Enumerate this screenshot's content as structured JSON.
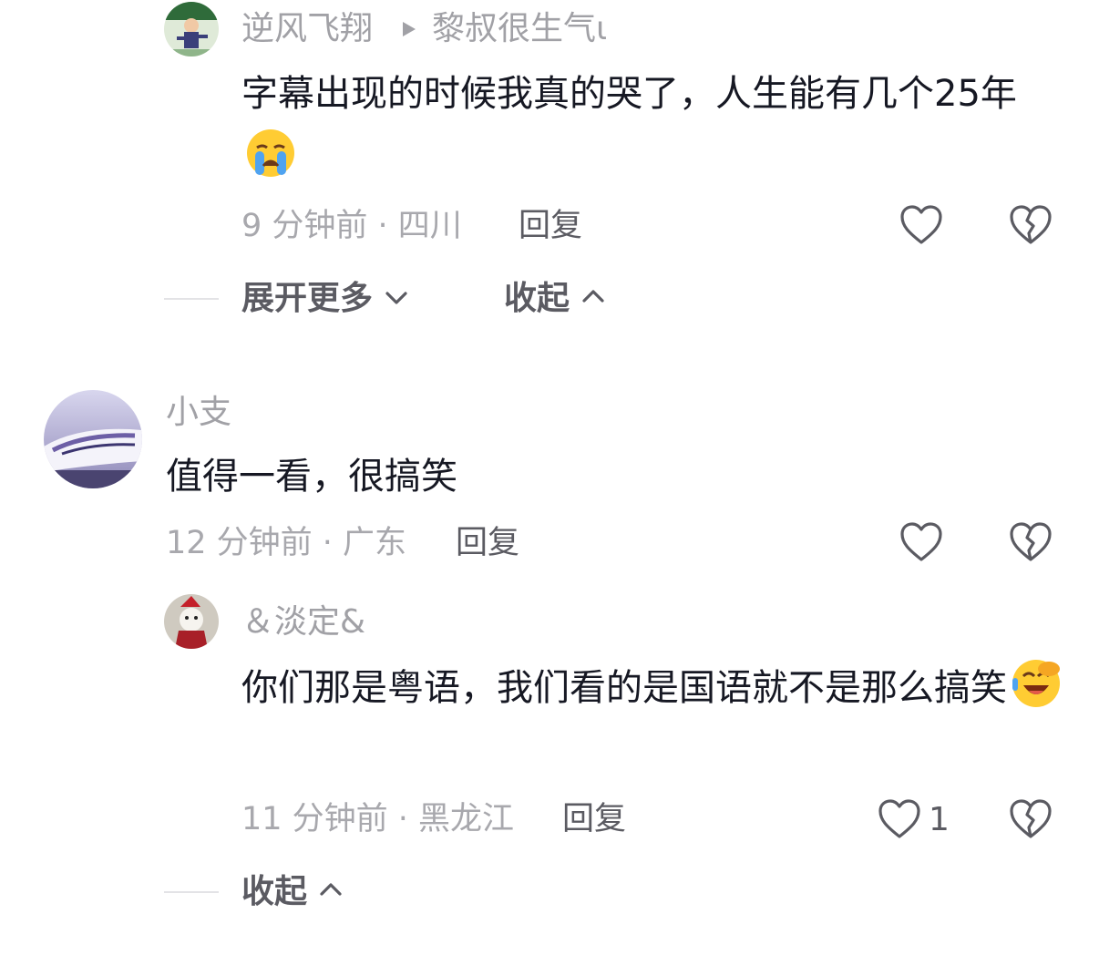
{
  "comments": [
    {
      "author": "逆风飞翔",
      "reply_to": "黎叔很生气ι",
      "content": "字幕出现的时候我真的哭了，人生能有几个25年",
      "emoji": "loudly-crying-face",
      "meta": "9 分钟前 · 四川",
      "reply_label": "回复",
      "like_count": ""
    },
    {
      "author": "小支",
      "content": "值得一看，很搞笑",
      "meta": "12 分钟前 · 广东",
      "reply_label": "回复",
      "like_count": ""
    },
    {
      "author": "＆淡定&",
      "content": "你们那是粤语，我们看的是国语就不是那么搞笑",
      "emoji": "face-with-hand-over-mouth-laughing",
      "meta": "11 分钟前 · 黑龙江",
      "reply_label": "回复",
      "like_count": "1"
    }
  ],
  "thread_actions": {
    "expand_more": "展开更多",
    "collapse": "收起"
  },
  "colors": {
    "primary_text": "#161823",
    "secondary_text": "#a1a1a6",
    "action_text": "#5b5b62",
    "divider": "#e3e3e6"
  }
}
